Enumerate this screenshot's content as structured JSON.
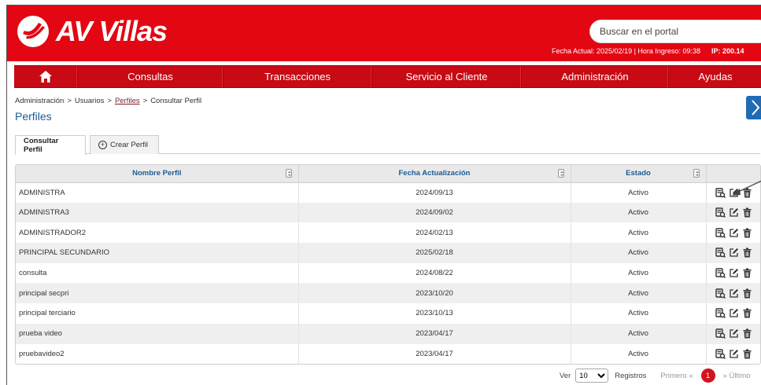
{
  "brand": {
    "name": "AV Villas"
  },
  "search": {
    "placeholder": "Buscar en el portal"
  },
  "header_info": {
    "fecha": "Fecha Actual: 2025/02/19 | Hora Ingreso: 09:38",
    "ip": "IP: 200.14"
  },
  "nav": {
    "home_icon": "home-icon",
    "items": [
      "Consultas",
      "Transacciones",
      "Servicio al Cliente",
      "Administración",
      "Ayudas"
    ]
  },
  "breadcrumb": {
    "items": [
      "Administración",
      "Usuarios",
      "Perfiles",
      "Consultar Perfil"
    ],
    "separator": ">"
  },
  "page": {
    "title": "Perfiles"
  },
  "tabs": [
    {
      "label": "Consultar Perfil"
    },
    {
      "label": "Crear Perfil"
    }
  ],
  "table": {
    "columns": [
      "Nombre Perfil",
      "Fecha Actualización",
      "Estado",
      ""
    ],
    "rows": [
      {
        "name": "ADMINISTRA",
        "date": "2024/09/13",
        "status": "Activo"
      },
      {
        "name": "ADMINISTRA3",
        "date": "2024/09/02",
        "status": "Activo"
      },
      {
        "name": "ADMINISTRADOR2",
        "date": "2024/02/13",
        "status": "Activo"
      },
      {
        "name": "PRINCIPAL SECUNDARIO",
        "date": "2025/02/18",
        "status": "Activo"
      },
      {
        "name": "consulta",
        "date": "2024/08/22",
        "status": "Activo"
      },
      {
        "name": "principal secpri",
        "date": "2023/10/20",
        "status": "Activo"
      },
      {
        "name": "principal terciario",
        "date": "2023/10/13",
        "status": "Activo"
      },
      {
        "name": "prueba video",
        "date": "2023/04/17",
        "status": "Activo"
      },
      {
        "name": "pruebavideo2",
        "date": "2023/04/17",
        "status": "Activo"
      }
    ],
    "row_actions": [
      "view-icon",
      "edit-icon",
      "trash-icon"
    ]
  },
  "pager": {
    "ver_label": "Ver",
    "page_size": "10",
    "registros_label": "Registros",
    "first_label": "Primero «",
    "current_page": "1",
    "last_label": "» Último"
  },
  "colors": {
    "brand_red": "#e30613",
    "nav_red": "#c70a14",
    "link_blue": "#1c5a96",
    "side_button_blue": "#1f6bb5"
  }
}
